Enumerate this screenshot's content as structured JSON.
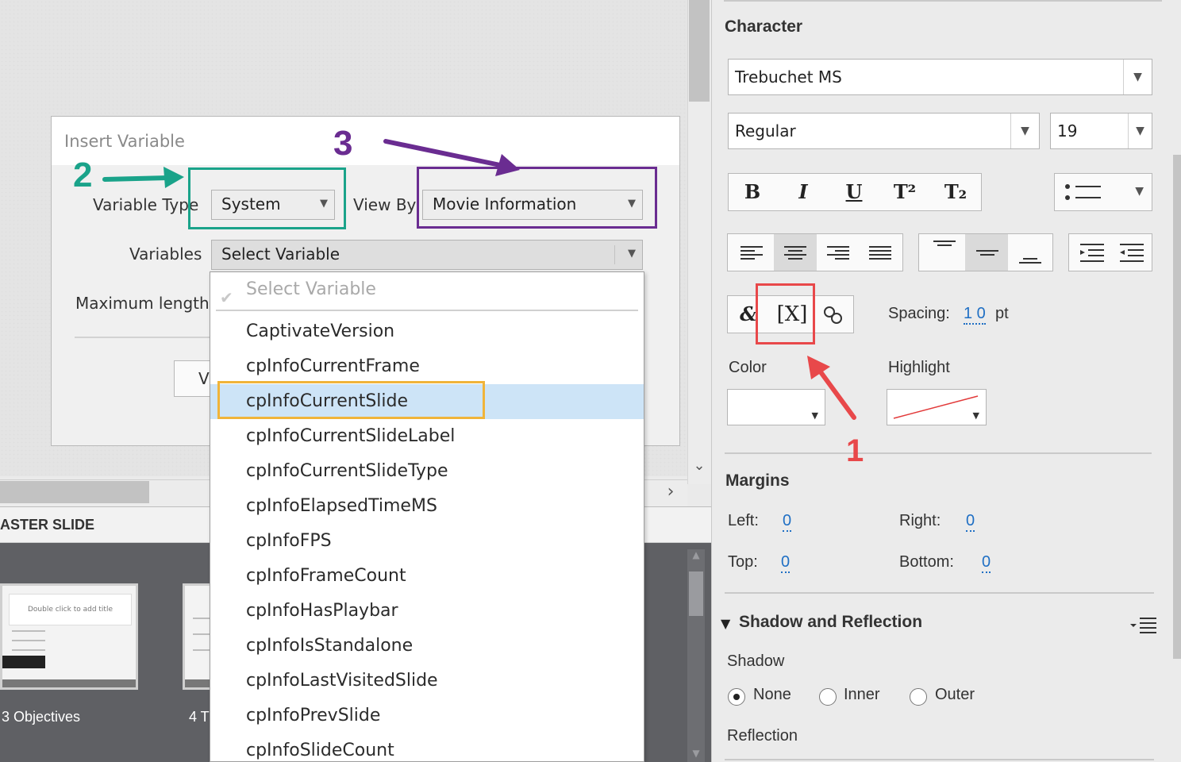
{
  "dialog": {
    "title": "Insert Variable",
    "variable_type_label": "Variable Type",
    "variable_type_value": "System",
    "view_by_label": "View By",
    "view_by_value": "Movie Information",
    "variables_label": "Variables",
    "variables_value": "Select Variable",
    "max_length_label": "Maximum length",
    "button_partial": "V"
  },
  "dropdown": {
    "header": "Select Variable",
    "items": [
      "CaptivateVersion",
      "cpInfoCurrentFrame",
      "cpInfoCurrentSlide",
      "cpInfoCurrentSlideLabel",
      "cpInfoCurrentSlideType",
      "cpInfoElapsedTimeMS",
      "cpInfoFPS",
      "cpInfoFrameCount",
      "cpInfoHasPlaybar",
      "cpInfoIsStandalone",
      "cpInfoLastVisitedSlide",
      "cpInfoPrevSlide",
      "cpInfoSlideCount"
    ],
    "selected": "cpInfoCurrentSlide"
  },
  "filmstrip": {
    "header": "ASTER SLIDE",
    "slides": [
      {
        "caption": "3 Objectives",
        "thumb_title": "Double click to add title"
      },
      {
        "caption": "4 T"
      }
    ]
  },
  "annotations": {
    "one": "1",
    "two": "2",
    "three": "3",
    "colors": {
      "green": "#1aa38a",
      "purple": "#6a2c91",
      "red": "#e8484a",
      "orange": "#f0b43a"
    }
  },
  "character": {
    "title": "Character",
    "font_family": "Trebuchet MS",
    "font_style": "Regular",
    "font_size": "19",
    "style_buttons": [
      "B",
      "I",
      "U",
      "T²",
      "T₂"
    ],
    "spacing_label": "Spacing:",
    "spacing_value": "1 0",
    "spacing_unit": "pt",
    "color_label": "Color",
    "highlight_label": "Highlight",
    "insert_symbol": "&",
    "insert_variable": "[X]"
  },
  "margins": {
    "title": "Margins",
    "left_label": "Left:",
    "left_value": "0",
    "right_label": "Right:",
    "right_value": "0",
    "top_label": "Top:",
    "top_value": "0",
    "bottom_label": "Bottom:",
    "bottom_value": "0"
  },
  "shadow": {
    "title": "Shadow and Reflection",
    "shadow_label": "Shadow",
    "options": [
      "None",
      "Inner",
      "Outer"
    ],
    "selected": "None",
    "reflection_label": "Reflection"
  }
}
